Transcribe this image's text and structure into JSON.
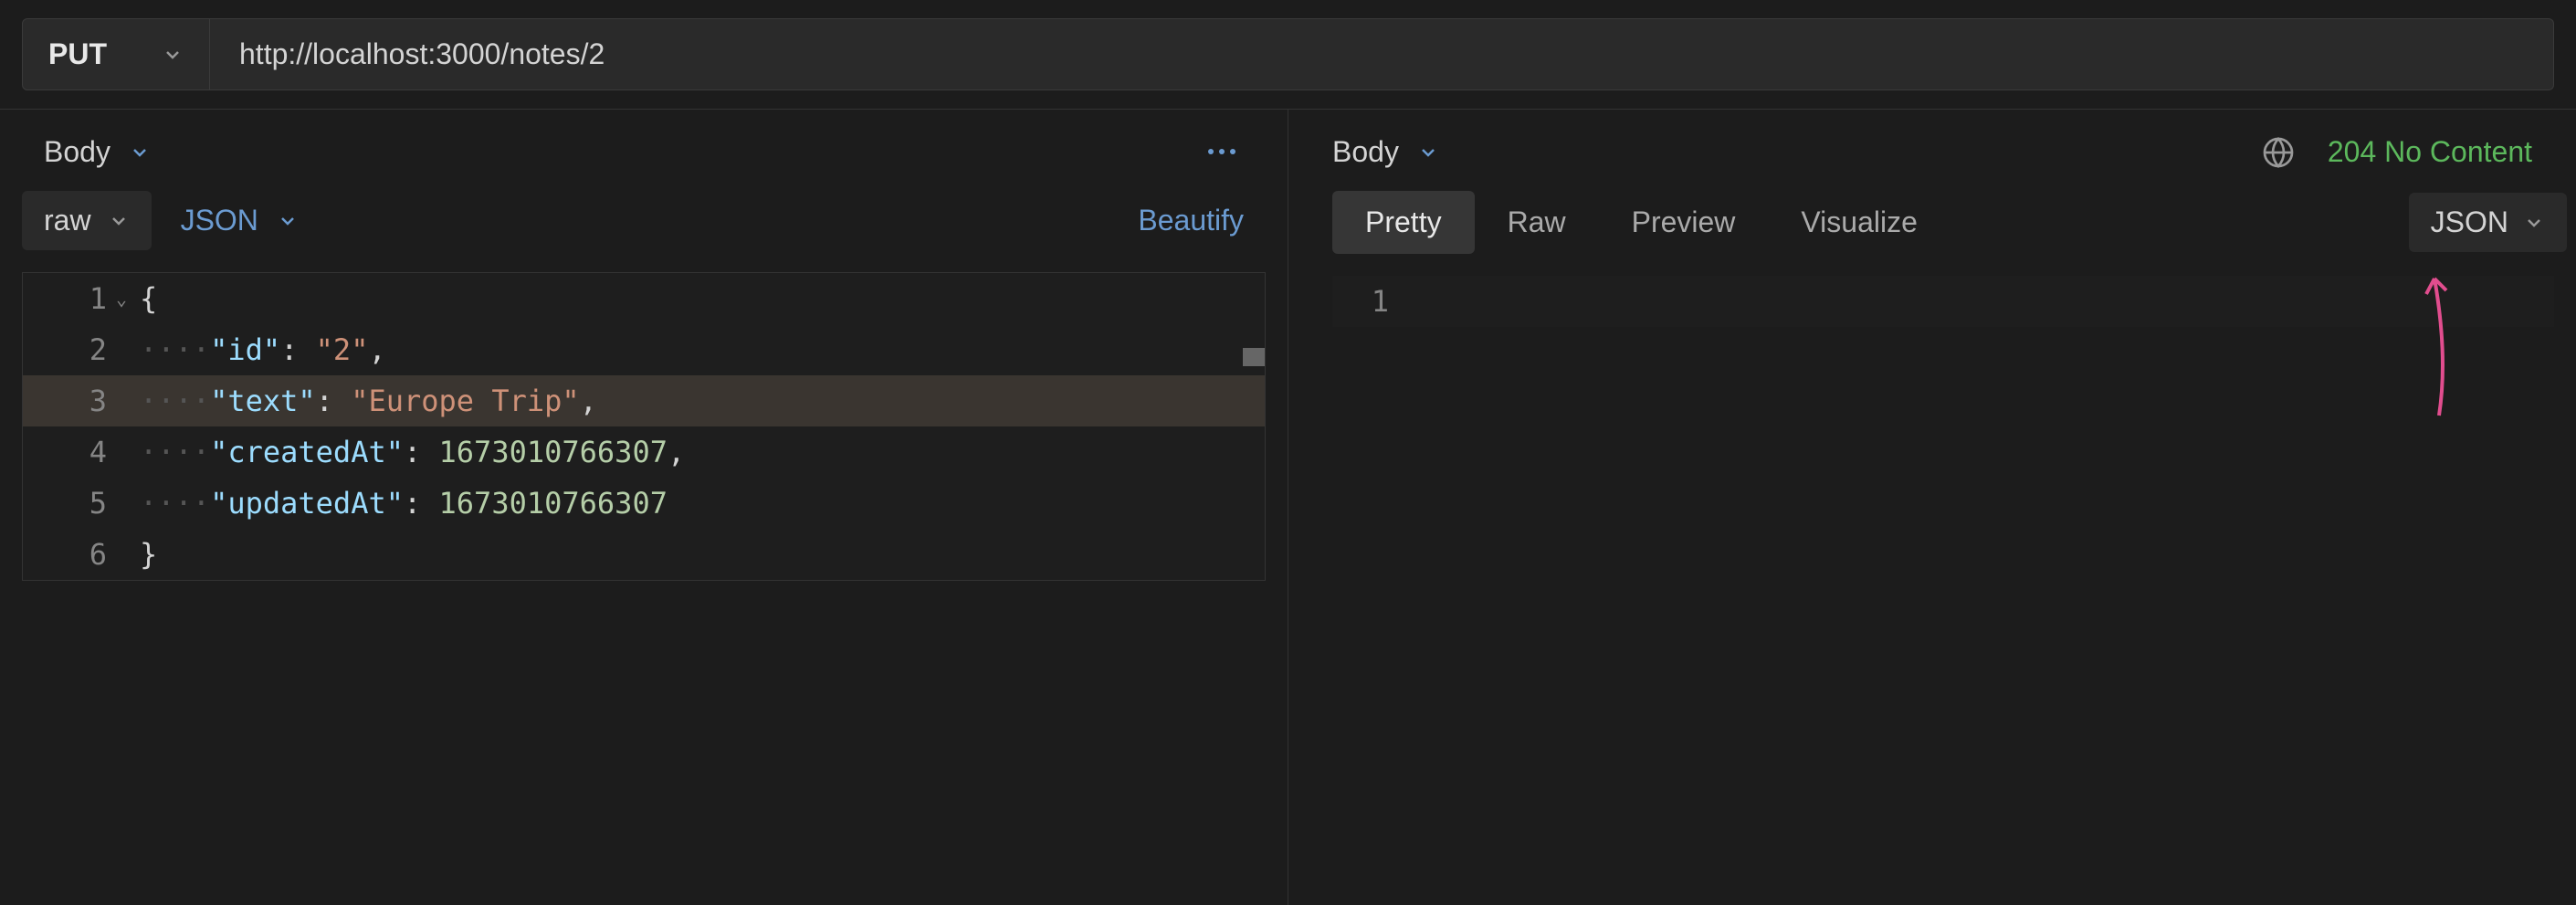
{
  "request": {
    "method": "PUT",
    "url": "http://localhost:3000/notes/2"
  },
  "left_panel": {
    "body_label": "Body",
    "raw_label": "raw",
    "json_label": "JSON",
    "beautify_label": "Beautify",
    "code_lines": [
      {
        "num": "1",
        "content": "{"
      },
      {
        "num": "2",
        "content_dots": "····",
        "key": "\"id\"",
        "sep": ": ",
        "value": "\"2\"",
        "tail": ","
      },
      {
        "num": "3",
        "content_dots": "····",
        "key": "\"text\"",
        "sep": ": ",
        "value": "\"Europe Trip\"",
        "tail": ","
      },
      {
        "num": "4",
        "content_dots": "····",
        "key": "\"createdAt\"",
        "sep": ": ",
        "value": "1673010766307",
        "tail": ","
      },
      {
        "num": "5",
        "content_dots": "····",
        "key": "\"updatedAt\"",
        "sep": ": ",
        "value": "1673010766307",
        "tail": ""
      },
      {
        "num": "6",
        "content": "}"
      }
    ]
  },
  "right_panel": {
    "body_label": "Body",
    "status": "204 No Content",
    "tabs": {
      "pretty": "Pretty",
      "raw": "Raw",
      "preview": "Preview",
      "visualize": "Visualize"
    },
    "json_label": "JSON",
    "line_num": "1"
  }
}
